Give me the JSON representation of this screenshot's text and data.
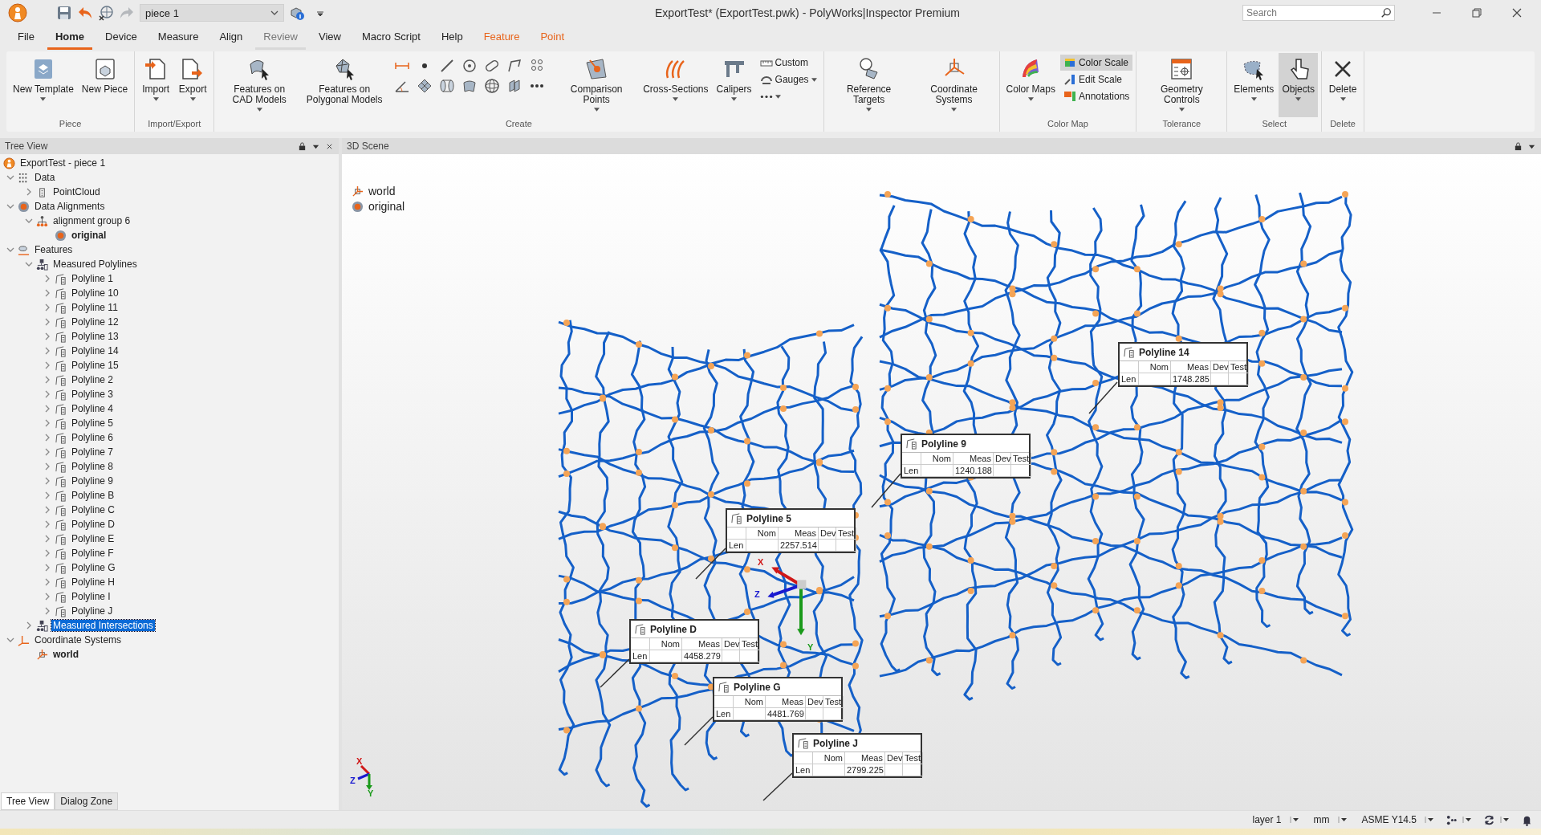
{
  "title_bar": {
    "piece_selector": "piece 1",
    "title": "ExportTest* (ExportTest.pwk) - PolyWorks|Inspector Premium",
    "search": {
      "placeholder": "Search"
    }
  },
  "menu_tabs": [
    {
      "label": "File",
      "kind": "standard",
      "selected": false
    },
    {
      "label": "Home",
      "kind": "standard",
      "selected": true
    },
    {
      "label": "Device",
      "kind": "standard",
      "selected": false
    },
    {
      "label": "Measure",
      "kind": "standard",
      "selected": false
    },
    {
      "label": "Align",
      "kind": "standard",
      "selected": false
    },
    {
      "label": "Review",
      "kind": "muted",
      "selected": false
    },
    {
      "label": "View",
      "kind": "standard",
      "selected": false
    },
    {
      "label": "Macro Script",
      "kind": "standard",
      "selected": false
    },
    {
      "label": "Help",
      "kind": "standard",
      "selected": false
    },
    {
      "label": "Feature",
      "kind": "contextual",
      "selected": false
    },
    {
      "label": "Point",
      "kind": "contextual",
      "selected": false
    }
  ],
  "ribbon": {
    "groups": [
      {
        "label": "Piece",
        "items": [
          {
            "kind": "large",
            "label": "New Template",
            "dropdown": true,
            "selected": false
          },
          {
            "kind": "large",
            "label": "New Piece",
            "dropdown": false,
            "selected": false
          }
        ]
      },
      {
        "label": "Import/Export",
        "items": [
          {
            "kind": "large",
            "label": "Import",
            "dropdown": true,
            "selected": false
          },
          {
            "kind": "large",
            "label": "Export",
            "dropdown": true,
            "selected": false
          }
        ]
      },
      {
        "label": "Create",
        "items": [
          {
            "kind": "large",
            "label": "Features on CAD Models",
            "dropdown": true,
            "selected": false
          },
          {
            "kind": "large",
            "label": "Features on Polygonal Models",
            "dropdown": false,
            "selected": false
          },
          {
            "kind": "tool-grid"
          },
          {
            "kind": "large",
            "label": "Comparison Points",
            "dropdown": true,
            "selected": false
          },
          {
            "kind": "large",
            "label": "Cross-Sections",
            "dropdown": true,
            "selected": false
          },
          {
            "kind": "large",
            "label": "Calipers",
            "dropdown": true,
            "selected": false
          },
          {
            "kind": "stack",
            "items": [
              {
                "kind": "small",
                "label": "Custom",
                "dropdown": false,
                "selected": false
              },
              {
                "kind": "small",
                "label": "Gauges",
                "dropdown": true,
                "selected": false
              },
              {
                "kind": "more",
                "dropdown": true,
                "selected": false
              }
            ]
          }
        ]
      },
      {
        "items": [
          {
            "kind": "large",
            "label": "Reference Targets",
            "dropdown": true,
            "selected": false
          },
          {
            "kind": "large",
            "label": "Coordinate Systems",
            "dropdown": true,
            "selected": false
          }
        ]
      },
      {
        "label": "Color Map",
        "items": [
          {
            "kind": "large",
            "label": "Color Maps",
            "dropdown": true,
            "selected": false
          },
          {
            "kind": "stack",
            "items": [
              {
                "kind": "small",
                "label": "Color Scale",
                "dropdown": false,
                "selected": true
              },
              {
                "kind": "small",
                "label": "Edit Scale",
                "dropdown": false,
                "selected": false
              },
              {
                "kind": "small",
                "label": "Annotations",
                "dropdown": false,
                "selected": false
              }
            ]
          }
        ]
      },
      {
        "label": "Tolerance",
        "items": [
          {
            "kind": "large",
            "label": "Geometry Controls",
            "dropdown": true,
            "selected": false
          }
        ]
      },
      {
        "label": "Select",
        "items": [
          {
            "kind": "large",
            "label": "Elements",
            "dropdown": true,
            "selected": false
          },
          {
            "kind": "large",
            "label": "Objects",
            "dropdown": true,
            "selected": true
          }
        ]
      },
      {
        "label": "Delete",
        "items": [
          {
            "kind": "large",
            "label": "Delete",
            "dropdown": true,
            "selected": false
          }
        ]
      }
    ]
  },
  "tree_view": {
    "title": "Tree View",
    "items": [
      {
        "label": "ExportTest - piece 1",
        "kind": "project",
        "selected": false,
        "children": [
          {
            "label": "Data",
            "kind": "data",
            "selected": false,
            "expanded": true,
            "children": [
              {
                "label": "PointCloud",
                "kind": "point-cloud",
                "selected": false,
                "expanded": false
              }
            ]
          },
          {
            "label": "Data Alignments",
            "kind": "alignments",
            "selected": false,
            "expanded": true,
            "children": [
              {
                "label": "alignment group 6",
                "kind": "alignment-group",
                "selected": false,
                "expanded": true,
                "children": [
                  {
                    "label": "original",
                    "kind": "alignment",
                    "selected": false,
                    "active": true
                  }
                ]
              }
            ]
          },
          {
            "label": "Features",
            "kind": "features",
            "selected": false,
            "expanded": true,
            "children": [
              {
                "label": "Measured Polylines",
                "kind": "feature-group",
                "selected": false,
                "expanded": true,
                "children": [
                  {
                    "label": "Polyline 1",
                    "kind": "polyline",
                    "selected": false,
                    "expanded": false
                  },
                  {
                    "label": "Polyline 10",
                    "kind": "polyline",
                    "selected": false,
                    "expanded": false
                  },
                  {
                    "label": "Polyline 11",
                    "kind": "polyline",
                    "selected": false,
                    "expanded": false
                  },
                  {
                    "label": "Polyline 12",
                    "kind": "polyline",
                    "selected": false,
                    "expanded": false
                  },
                  {
                    "label": "Polyline 13",
                    "kind": "polyline",
                    "selected": false,
                    "expanded": false
                  },
                  {
                    "label": "Polyline 14",
                    "kind": "polyline",
                    "selected": false,
                    "expanded": false
                  },
                  {
                    "label": "Polyline 15",
                    "kind": "polyline",
                    "selected": false,
                    "expanded": false
                  },
                  {
                    "label": "Polyline 2",
                    "kind": "polyline",
                    "selected": false,
                    "expanded": false
                  },
                  {
                    "label": "Polyline 3",
                    "kind": "polyline",
                    "selected": false,
                    "expanded": false
                  },
                  {
                    "label": "Polyline 4",
                    "kind": "polyline",
                    "selected": false,
                    "expanded": false
                  },
                  {
                    "label": "Polyline 5",
                    "kind": "polyline",
                    "selected": false,
                    "expanded": false
                  },
                  {
                    "label": "Polyline 6",
                    "kind": "polyline",
                    "selected": false,
                    "expanded": false
                  },
                  {
                    "label": "Polyline 7",
                    "kind": "polyline",
                    "selected": false,
                    "expanded": false
                  },
                  {
                    "label": "Polyline 8",
                    "kind": "polyline",
                    "selected": false,
                    "expanded": false
                  },
                  {
                    "label": "Polyline 9",
                    "kind": "polyline",
                    "selected": false,
                    "expanded": false
                  },
                  {
                    "label": "Polyline B",
                    "kind": "polyline",
                    "selected": false,
                    "expanded": false
                  },
                  {
                    "label": "Polyline C",
                    "kind": "polyline",
                    "selected": false,
                    "expanded": false
                  },
                  {
                    "label": "Polyline D",
                    "kind": "polyline",
                    "selected": false,
                    "expanded": false
                  },
                  {
                    "label": "Polyline E",
                    "kind": "polyline",
                    "selected": false,
                    "expanded": false
                  },
                  {
                    "label": "Polyline F",
                    "kind": "polyline",
                    "selected": false,
                    "expanded": false
                  },
                  {
                    "label": "Polyline G",
                    "kind": "polyline",
                    "selected": false,
                    "expanded": false
                  },
                  {
                    "label": "Polyline H",
                    "kind": "polyline",
                    "selected": false,
                    "expanded": false
                  },
                  {
                    "label": "Polyline I",
                    "kind": "polyline",
                    "selected": false,
                    "expanded": false
                  },
                  {
                    "label": "Polyline J",
                    "kind": "polyline",
                    "selected": false,
                    "expanded": false
                  }
                ]
              },
              {
                "label": "Measured Intersections",
                "kind": "feature-group",
                "selected": true,
                "expanded": false
              }
            ]
          },
          {
            "label": "Coordinate Systems",
            "kind": "coordinate-systems",
            "selected": false,
            "expanded": true,
            "children": [
              {
                "label": "world",
                "kind": "coordinate-system",
                "selected": false,
                "active": true
              }
            ]
          }
        ]
      }
    ]
  },
  "panel_tabs": [
    {
      "label": "Tree View",
      "selected": true
    },
    {
      "label": "Dialog Zone",
      "selected": false
    }
  ],
  "scene": {
    "title": "3D Scene",
    "legend": [
      {
        "label": "world",
        "kind": "coordinate-system"
      },
      {
        "label": "original",
        "kind": "alignment"
      }
    ],
    "callouts": [
      {
        "title": "Polyline 14",
        "columns": [
          "Nom",
          "Meas",
          "Dev",
          "Test"
        ],
        "rows": [
          {
            "label": "Len",
            "meas": "1748.285"
          }
        ]
      },
      {
        "title": "Polyline 9",
        "columns": [
          "Nom",
          "Meas",
          "Dev",
          "Test"
        ],
        "rows": [
          {
            "label": "Len",
            "meas": "1240.188"
          }
        ]
      },
      {
        "title": "Polyline 5",
        "columns": [
          "Nom",
          "Meas",
          "Dev",
          "Test"
        ],
        "rows": [
          {
            "label": "Len",
            "meas": "2257.514"
          }
        ]
      },
      {
        "title": "Polyline D",
        "columns": [
          "Nom",
          "Meas",
          "Dev",
          "Test"
        ],
        "rows": [
          {
            "label": "Len",
            "meas": "4458.279"
          }
        ]
      },
      {
        "title": "Polyline G",
        "columns": [
          "Nom",
          "Meas",
          "Dev",
          "Test"
        ],
        "rows": [
          {
            "label": "Len",
            "meas": "4481.769"
          }
        ]
      },
      {
        "title": "Polyline J",
        "columns": [
          "Nom",
          "Meas",
          "Dev",
          "Test"
        ],
        "rows": [
          {
            "label": "Len",
            "meas": "2799.225"
          }
        ]
      }
    ],
    "triads": [
      {
        "x": "X",
        "y": "Y",
        "z": "Z"
      },
      {
        "x": "X",
        "y": "Y",
        "z": "Z"
      }
    ]
  },
  "status_bar": {
    "selectors": [
      {
        "label": "layer 1"
      },
      {
        "label": "mm"
      },
      {
        "label": "ASME Y14.5"
      }
    ]
  }
}
